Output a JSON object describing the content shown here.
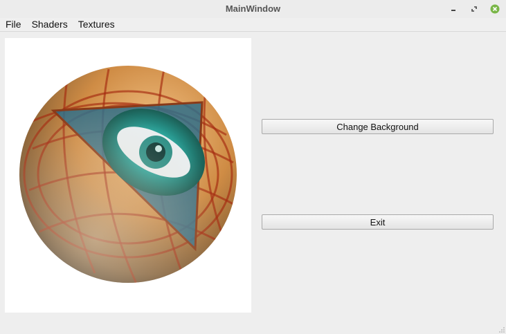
{
  "window": {
    "title": "MainWindow",
    "controls": [
      {
        "name": "minimize-icon"
      },
      {
        "name": "restore-icon"
      },
      {
        "name": "close-icon",
        "color": "#7ab648"
      }
    ]
  },
  "menubar": {
    "items": [
      "File",
      "Shaders",
      "Textures"
    ]
  },
  "viewport": {
    "background": "#ffffff",
    "content": "textured-sphere"
  },
  "buttons": {
    "change_background": "Change Background",
    "exit": "Exit"
  }
}
